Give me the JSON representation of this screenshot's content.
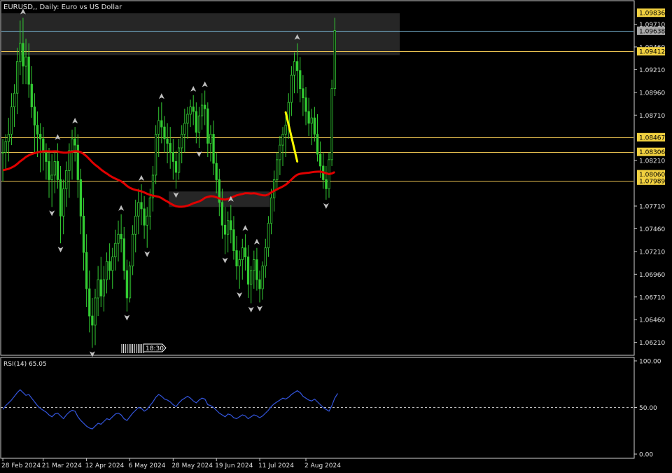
{
  "title": "EURUSD,, Daily:  Euro vs US Dollar",
  "timer_label": "18:30",
  "colors": {
    "background": "#000000",
    "frame": "#cfcfcf",
    "candle": "#33cc33",
    "ma": "#e00000",
    "rsi_line": "#3355dd",
    "zone": "#2a2a2a",
    "level_line": "#e8c050",
    "price_box": "#f0d040",
    "current_box": "#a8a8a8",
    "blue_line": "#7ab8d8",
    "trend_line": "#ffff00",
    "text": "#e0e0e0",
    "fractal": "#c0c0c0"
  },
  "chart_data": {
    "type": "candlestick",
    "symbol": "EURUSD",
    "timeframe": "Daily",
    "description": "Euro vs US Dollar",
    "price_axis": {
      "ylim": [
        1.0603,
        1.0993
      ],
      "ticks": [
        "1.09710",
        "1.09460",
        "1.09210",
        "1.08960",
        "1.08710",
        "1.08210",
        "1.07710",
        "1.07460",
        "1.07210",
        "1.06960",
        "1.06710",
        "1.06460",
        "1.06210"
      ]
    },
    "level_labels": [
      {
        "price": 1.09836,
        "label": "1.09836",
        "style": "level"
      },
      {
        "price": 1.09638,
        "label": "1.09638",
        "style": "current"
      },
      {
        "price": 1.09412,
        "label": "1.09412",
        "style": "level"
      },
      {
        "price": 1.08467,
        "label": "1.08467",
        "style": "level"
      },
      {
        "price": 1.08306,
        "label": "1.08306",
        "style": "level"
      },
      {
        "price": 1.0806,
        "label": "1.08060",
        "style": "level"
      },
      {
        "price": 1.07989,
        "label": "1.07989",
        "style": "level"
      }
    ],
    "horizontal_lines": [
      {
        "price": 1.09638,
        "style": "blue"
      },
      {
        "price": 1.09412,
        "style": "level"
      },
      {
        "price": 1.08467,
        "style": "level"
      },
      {
        "price": 1.08306,
        "style": "level"
      },
      {
        "price": 1.07989,
        "style": "level"
      }
    ],
    "zones": [
      {
        "from_bar": 0,
        "to_bar": 138,
        "price_top": 1.0983,
        "price_bottom": 1.0937
      },
      {
        "from_bar": 58,
        "to_bar": 93,
        "price_top": 1.0787,
        "price_bottom": 1.077
      }
    ],
    "trend_line": {
      "from_bar": 98,
      "from_price": 1.0874,
      "to_bar": 102,
      "to_price": 1.082
    },
    "x_labels": [
      {
        "bar": 0,
        "label": "28 Feb 2024"
      },
      {
        "bar": 14,
        "label": "21 Mar 2024"
      },
      {
        "bar": 29,
        "label": "12 Apr 2024"
      },
      {
        "bar": 44,
        "label": "6 May 2024"
      },
      {
        "bar": 59,
        "label": "28 May 2024"
      },
      {
        "bar": 74,
        "label": "19 Jun 2024"
      },
      {
        "bar": 89,
        "label": "11 Jul 2024"
      },
      {
        "bar": 105,
        "label": "2 Aug 2024"
      }
    ],
    "bars_total": 219,
    "ohlc": [
      [
        1.083,
        1.0845,
        1.0798,
        1.083
      ],
      [
        1.083,
        1.085,
        1.0812,
        1.0842
      ],
      [
        1.0842,
        1.0868,
        1.082,
        1.085
      ],
      [
        1.085,
        1.0895,
        1.0838,
        1.088
      ],
      [
        1.088,
        1.0905,
        1.0858,
        1.0895
      ],
      [
        1.0895,
        1.0945,
        1.0872,
        1.093
      ],
      [
        1.093,
        1.0975,
        1.0915,
        1.095
      ],
      [
        1.095,
        1.0978,
        1.0905,
        1.0925
      ],
      [
        1.0925,
        1.0955,
        1.0905,
        1.0935
      ],
      [
        1.0935,
        1.095,
        1.089,
        1.0905
      ],
      [
        1.0905,
        1.0925,
        1.0868,
        1.088
      ],
      [
        1.088,
        1.0895,
        1.083,
        1.086
      ],
      [
        1.086,
        1.0875,
        1.0825,
        1.085
      ],
      [
        1.085,
        1.0862,
        1.0808,
        1.0845
      ],
      [
        1.0845,
        1.0858,
        1.081,
        1.083
      ],
      [
        1.083,
        1.084,
        1.08,
        1.082
      ],
      [
        1.082,
        1.0835,
        1.078,
        1.08
      ],
      [
        1.08,
        1.0828,
        1.077,
        1.0805
      ],
      [
        1.0805,
        1.083,
        1.0785,
        1.082
      ],
      [
        1.082,
        1.084,
        1.079,
        1.08
      ],
      [
        1.08,
        1.0815,
        1.073,
        1.076
      ],
      [
        1.076,
        1.08,
        1.074,
        1.079
      ],
      [
        1.079,
        1.082,
        1.077,
        1.081
      ],
      [
        1.081,
        1.084,
        1.078,
        1.0832
      ],
      [
        1.0832,
        1.0855,
        1.08,
        1.0845
      ],
      [
        1.0845,
        1.0858,
        1.082,
        1.0838
      ],
      [
        1.0838,
        1.085,
        1.078,
        1.08
      ],
      [
        1.08,
        1.0812,
        1.074,
        1.076
      ],
      [
        1.076,
        1.078,
        1.07,
        1.072
      ],
      [
        1.072,
        1.074,
        1.066,
        1.068
      ],
      [
        1.068,
        1.07,
        1.0632,
        1.065
      ],
      [
        1.065,
        1.067,
        1.0615,
        1.064
      ],
      [
        1.064,
        1.068,
        1.0618,
        1.067
      ],
      [
        1.067,
        1.0705,
        1.065,
        1.069
      ],
      [
        1.069,
        1.0715,
        1.066,
        1.0672
      ],
      [
        1.0672,
        1.0705,
        1.0655,
        1.069
      ],
      [
        1.069,
        1.072,
        1.0675,
        1.071
      ],
      [
        1.071,
        1.073,
        1.069,
        1.07
      ],
      [
        1.07,
        1.0725,
        1.068,
        1.0715
      ],
      [
        1.0715,
        1.0745,
        1.07,
        1.073
      ],
      [
        1.073,
        1.0755,
        1.071,
        1.074
      ],
      [
        1.074,
        1.0762,
        1.072,
        1.0735
      ],
      [
        1.0735,
        1.0748,
        1.069,
        1.07
      ],
      [
        1.07,
        1.0712,
        1.0655,
        1.067
      ],
      [
        1.067,
        1.071,
        1.0665,
        1.0705
      ],
      [
        1.0705,
        1.075,
        1.0695,
        1.074
      ],
      [
        1.074,
        1.0778,
        1.072,
        1.076
      ],
      [
        1.076,
        1.079,
        1.074,
        1.0775
      ],
      [
        1.0775,
        1.0795,
        1.075,
        1.0768
      ],
      [
        1.0768,
        1.0782,
        1.0735,
        1.075
      ],
      [
        1.075,
        1.077,
        1.0725,
        1.076
      ],
      [
        1.076,
        1.079,
        1.0745,
        1.078
      ],
      [
        1.078,
        1.0815,
        1.0765,
        1.0805
      ],
      [
        1.0805,
        1.086,
        1.0795,
        1.085
      ],
      [
        1.085,
        1.088,
        1.0825,
        1.0865
      ],
      [
        1.0865,
        1.0885,
        1.084,
        1.0858
      ],
      [
        1.0858,
        1.087,
        1.083,
        1.0845
      ],
      [
        1.0845,
        1.0862,
        1.0818,
        1.084
      ],
      [
        1.084,
        1.0858,
        1.0812,
        1.083
      ],
      [
        1.083,
        1.0845,
        1.08,
        1.082
      ],
      [
        1.082,
        1.0832,
        1.079,
        1.0808
      ],
      [
        1.0808,
        1.0845,
        1.08,
        1.0835
      ],
      [
        1.0835,
        1.086,
        1.0818,
        1.085
      ],
      [
        1.085,
        1.0878,
        1.083,
        1.0862
      ],
      [
        1.0862,
        1.088,
        1.0845,
        1.0872
      ],
      [
        1.0872,
        1.0888,
        1.0858,
        1.088
      ],
      [
        1.088,
        1.0893,
        1.086,
        1.0875
      ],
      [
        1.0875,
        1.0885,
        1.084,
        1.0852
      ],
      [
        1.0852,
        1.088,
        1.0835,
        1.087
      ],
      [
        1.087,
        1.0895,
        1.0855,
        1.0882
      ],
      [
        1.0882,
        1.0898,
        1.086,
        1.0878
      ],
      [
        1.0878,
        1.0885,
        1.0825,
        1.084
      ],
      [
        1.084,
        1.086,
        1.082,
        1.085
      ],
      [
        1.085,
        1.0865,
        1.0805,
        1.0818
      ],
      [
        1.0818,
        1.083,
        1.0785,
        1.08
      ],
      [
        1.08,
        1.0812,
        1.076,
        1.0775
      ],
      [
        1.0775,
        1.079,
        1.0735,
        1.075
      ],
      [
        1.075,
        1.077,
        1.0718,
        1.074
      ],
      [
        1.074,
        1.0765,
        1.072,
        1.0755
      ],
      [
        1.0755,
        1.0772,
        1.073,
        1.0745
      ],
      [
        1.0745,
        1.076,
        1.0712,
        1.0722
      ],
      [
        1.0722,
        1.0738,
        1.069,
        1.0705
      ],
      [
        1.0705,
        1.0722,
        1.068,
        1.0712
      ],
      [
        1.0712,
        1.0735,
        1.069,
        1.0725
      ],
      [
        1.0725,
        1.074,
        1.07,
        1.0715
      ],
      [
        1.0715,
        1.0728,
        1.067,
        1.0685
      ],
      [
        1.0685,
        1.0705,
        1.0664,
        1.07
      ],
      [
        1.07,
        1.0722,
        1.068,
        1.0712
      ],
      [
        1.0712,
        1.0725,
        1.0678,
        1.069
      ],
      [
        1.069,
        1.07,
        1.0665,
        1.068
      ],
      [
        1.068,
        1.071,
        1.0668,
        1.0705
      ],
      [
        1.0705,
        1.0735,
        1.0692,
        1.0725
      ],
      [
        1.0725,
        1.076,
        1.0715,
        1.0752
      ],
      [
        1.0752,
        1.079,
        1.074,
        1.078
      ],
      [
        1.078,
        1.081,
        1.0765,
        1.08
      ],
      [
        1.08,
        1.083,
        1.0788,
        1.0822
      ],
      [
        1.0822,
        1.0848,
        1.0805,
        1.0838
      ],
      [
        1.0838,
        1.0858,
        1.0815,
        1.085
      ],
      [
        1.085,
        1.087,
        1.0825,
        1.086
      ],
      [
        1.086,
        1.0895,
        1.0845,
        1.0885
      ],
      [
        1.0885,
        1.0925,
        1.087,
        1.0915
      ],
      [
        1.0915,
        1.094,
        1.0895,
        1.093
      ],
      [
        1.093,
        1.095,
        1.0895,
        1.092
      ],
      [
        1.092,
        1.0935,
        1.0885,
        1.09
      ],
      [
        1.09,
        1.0915,
        1.087,
        1.089
      ],
      [
        1.089,
        1.0902,
        1.086,
        1.0875
      ],
      [
        1.0875,
        1.089,
        1.0848,
        1.0862
      ],
      [
        1.0862,
        1.0878,
        1.0838,
        1.0868
      ],
      [
        1.0868,
        1.088,
        1.0842,
        1.085
      ],
      [
        1.085,
        1.0872,
        1.082,
        1.0828
      ],
      [
        1.0828,
        1.0842,
        1.0802,
        1.0815
      ],
      [
        1.0815,
        1.083,
        1.079,
        1.08
      ],
      [
        1.08,
        1.0815,
        1.0778,
        1.079
      ],
      [
        1.079,
        1.083,
        1.078,
        1.0822
      ],
      [
        1.0822,
        1.091,
        1.0815,
        1.09
      ],
      [
        1.09,
        1.0978,
        1.0892,
        1.0964
      ]
    ]
  },
  "rsi": {
    "label": "RSI(14) 65.05",
    "levels": [
      "100.00",
      "50.00",
      "0.00"
    ],
    "level_line": 50,
    "ylim": [
      0,
      100
    ],
    "values": [
      48,
      52,
      55,
      58,
      62,
      66,
      69,
      66,
      63,
      64,
      60,
      56,
      52,
      49,
      47,
      45,
      42,
      40,
      43,
      44,
      41,
      38,
      42,
      45,
      47,
      46,
      40,
      36,
      33,
      30,
      28,
      27,
      30,
      33,
      32,
      35,
      38,
      37,
      40,
      43,
      44,
      42,
      38,
      36,
      40,
      44,
      47,
      50,
      49,
      46,
      48,
      52,
      56,
      61,
      64,
      62,
      59,
      58,
      56,
      53,
      51,
      55,
      58,
      60,
      62,
      60,
      57,
      55,
      58,
      60,
      59,
      53,
      52,
      50,
      47,
      44,
      42,
      40,
      43,
      42,
      39,
      38,
      40,
      42,
      41,
      38,
      40,
      42,
      41,
      39,
      41,
      44,
      47,
      51,
      54,
      56,
      58,
      60,
      59,
      61,
      64,
      66,
      68,
      66,
      62,
      60,
      58,
      57,
      59,
      56,
      53,
      50,
      48,
      46,
      52,
      60,
      65
    ]
  }
}
